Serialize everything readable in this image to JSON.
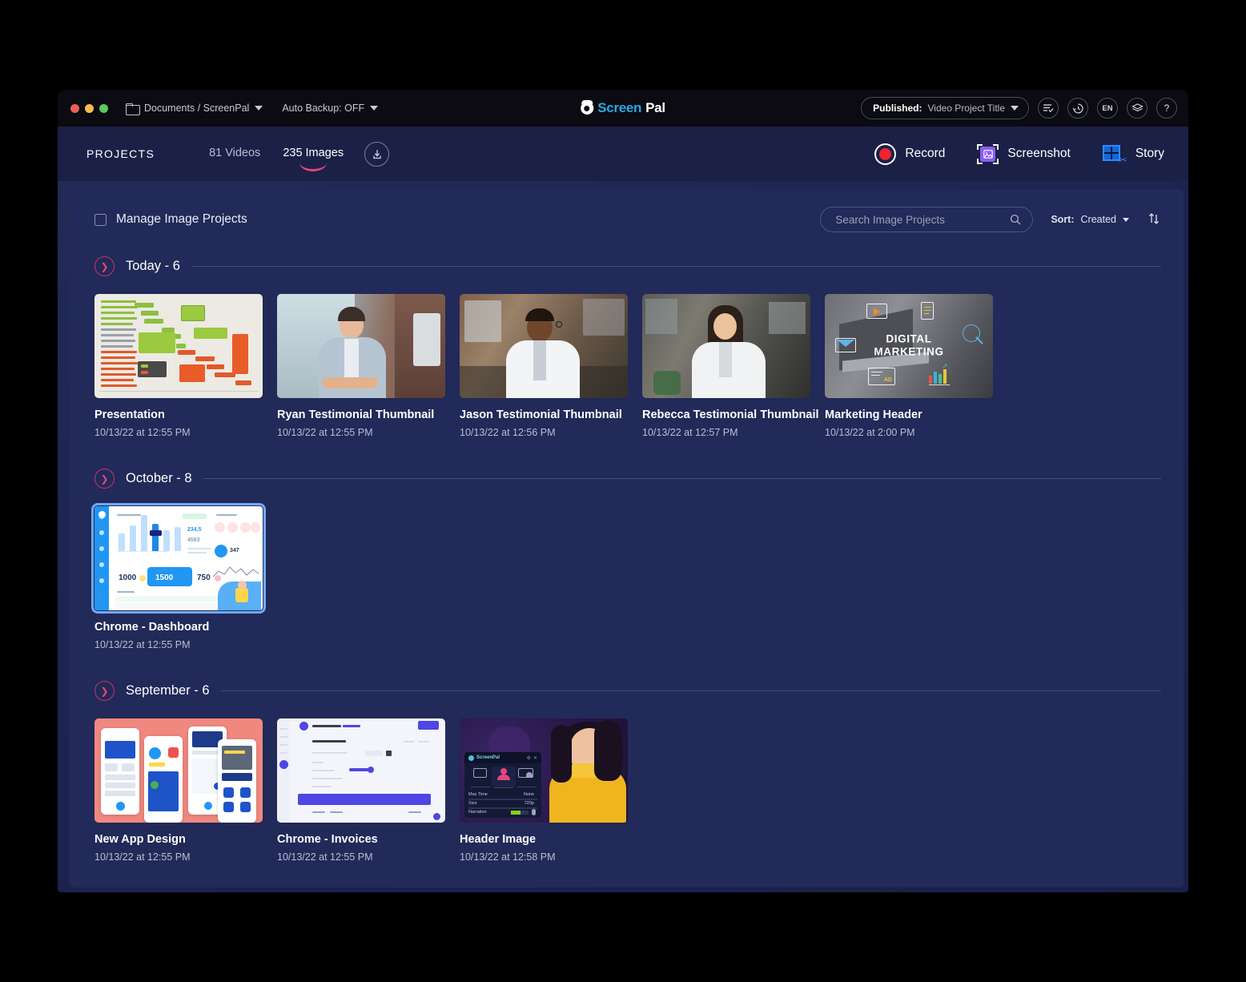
{
  "titlebar": {
    "breadcrumb": "Documents / ScreenPal",
    "autobackup": "Auto Backup: OFF",
    "logo_screen": "Screen",
    "logo_pal": "Pal",
    "published_label": "Published:",
    "published_title": "Video Project Title",
    "lang": "EN",
    "help": "?"
  },
  "subnav": {
    "projects": "PROJECTS",
    "videos": "81 Videos",
    "images": "235 Images",
    "record": "Record",
    "screenshot": "Screenshot",
    "story": "Story"
  },
  "toolbar": {
    "manage_label": "Manage Image Projects",
    "search_placeholder": "Search Image Projects",
    "search_value": "",
    "sort_key": "Sort:",
    "sort_value": "Created"
  },
  "groups": [
    {
      "name": "Today",
      "count": "6",
      "title": "Today",
      "heading": "Today - 6",
      "items": [
        {
          "title": "Presentation",
          "date": "10/13/22 at 12:55 PM",
          "art": "gantt"
        },
        {
          "title": "Ryan Testimonial Thumbnail",
          "date": "10/13/22 at 12:55 PM",
          "art": "ryan"
        },
        {
          "title": "Jason Testimonial Thumbnail",
          "date": "10/13/22 at 12:56 PM",
          "art": "jason"
        },
        {
          "title": "Rebecca Testimonial Thumbnail",
          "date": "10/13/22 at 12:57 PM",
          "art": "rebecca"
        },
        {
          "title": "Marketing Header",
          "date": "10/13/22 at 2:00 PM",
          "art": "marketing"
        }
      ]
    },
    {
      "name": "October",
      "count": "8",
      "heading": "October - 8",
      "items": [
        {
          "title": "Chrome - Dashboard",
          "date": "10/13/22 at 12:55 PM",
          "art": "dashboard",
          "selected": true
        }
      ]
    },
    {
      "name": "September",
      "count": "6",
      "heading": "September - 6",
      "items": [
        {
          "title": "New App Design",
          "date": "10/13/22 at 12:55 PM",
          "art": "phones"
        },
        {
          "title": "Chrome - Invoices",
          "date": "10/13/22 at 12:55 PM",
          "art": "invoice"
        },
        {
          "title": "Header Image",
          "date": "10/13/22 at 12:58 PM",
          "art": "headerimg"
        }
      ]
    }
  ],
  "marketing_overlay": {
    "line1": "DIGITAL",
    "line2": "MARKETING",
    "ad_label": "AD"
  },
  "dashboard_stats": {
    "s1": "1000",
    "s2": "1500",
    "s3": "750",
    "big1": "234,5",
    "big2": "4563",
    "donut": "347"
  },
  "header_overlay": {
    "brand": "ScreenPal",
    "rows": [
      {
        "k": "Max Time",
        "v": "None"
      },
      {
        "k": "Size",
        "v": "720p"
      },
      {
        "k": "Narration",
        "v": ""
      }
    ]
  },
  "colors": {
    "accent_pink": "#e8447d",
    "panel": "#212a58",
    "subnav": "#1b2046",
    "brand_blue": "#27a9e1",
    "record_red": "#f0232f",
    "screenshot_purple": "#8b5cf6",
    "story_blue": "#2b8cff",
    "selected_outline": "#6fa8ff"
  }
}
